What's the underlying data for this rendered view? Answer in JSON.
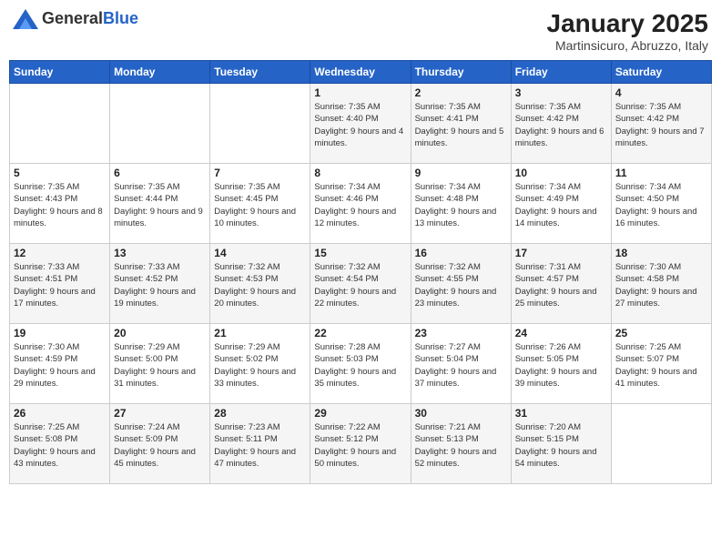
{
  "header": {
    "logo_general": "General",
    "logo_blue": "Blue",
    "title": "January 2025",
    "subtitle": "Martinsicuro, Abruzzo, Italy"
  },
  "days_of_week": [
    "Sunday",
    "Monday",
    "Tuesday",
    "Wednesday",
    "Thursday",
    "Friday",
    "Saturday"
  ],
  "weeks": [
    [
      {
        "day": "",
        "sunrise": "",
        "sunset": "",
        "daylight": "",
        "empty": true
      },
      {
        "day": "",
        "sunrise": "",
        "sunset": "",
        "daylight": "",
        "empty": true
      },
      {
        "day": "",
        "sunrise": "",
        "sunset": "",
        "daylight": "",
        "empty": true
      },
      {
        "day": "1",
        "sunrise": "Sunrise: 7:35 AM",
        "sunset": "Sunset: 4:40 PM",
        "daylight": "Daylight: 9 hours and 4 minutes."
      },
      {
        "day": "2",
        "sunrise": "Sunrise: 7:35 AM",
        "sunset": "Sunset: 4:41 PM",
        "daylight": "Daylight: 9 hours and 5 minutes."
      },
      {
        "day": "3",
        "sunrise": "Sunrise: 7:35 AM",
        "sunset": "Sunset: 4:42 PM",
        "daylight": "Daylight: 9 hours and 6 minutes."
      },
      {
        "day": "4",
        "sunrise": "Sunrise: 7:35 AM",
        "sunset": "Sunset: 4:42 PM",
        "daylight": "Daylight: 9 hours and 7 minutes."
      }
    ],
    [
      {
        "day": "5",
        "sunrise": "Sunrise: 7:35 AM",
        "sunset": "Sunset: 4:43 PM",
        "daylight": "Daylight: 9 hours and 8 minutes."
      },
      {
        "day": "6",
        "sunrise": "Sunrise: 7:35 AM",
        "sunset": "Sunset: 4:44 PM",
        "daylight": "Daylight: 9 hours and 9 minutes."
      },
      {
        "day": "7",
        "sunrise": "Sunrise: 7:35 AM",
        "sunset": "Sunset: 4:45 PM",
        "daylight": "Daylight: 9 hours and 10 minutes."
      },
      {
        "day": "8",
        "sunrise": "Sunrise: 7:34 AM",
        "sunset": "Sunset: 4:46 PM",
        "daylight": "Daylight: 9 hours and 12 minutes."
      },
      {
        "day": "9",
        "sunrise": "Sunrise: 7:34 AM",
        "sunset": "Sunset: 4:48 PM",
        "daylight": "Daylight: 9 hours and 13 minutes."
      },
      {
        "day": "10",
        "sunrise": "Sunrise: 7:34 AM",
        "sunset": "Sunset: 4:49 PM",
        "daylight": "Daylight: 9 hours and 14 minutes."
      },
      {
        "day": "11",
        "sunrise": "Sunrise: 7:34 AM",
        "sunset": "Sunset: 4:50 PM",
        "daylight": "Daylight: 9 hours and 16 minutes."
      }
    ],
    [
      {
        "day": "12",
        "sunrise": "Sunrise: 7:33 AM",
        "sunset": "Sunset: 4:51 PM",
        "daylight": "Daylight: 9 hours and 17 minutes."
      },
      {
        "day": "13",
        "sunrise": "Sunrise: 7:33 AM",
        "sunset": "Sunset: 4:52 PM",
        "daylight": "Daylight: 9 hours and 19 minutes."
      },
      {
        "day": "14",
        "sunrise": "Sunrise: 7:32 AM",
        "sunset": "Sunset: 4:53 PM",
        "daylight": "Daylight: 9 hours and 20 minutes."
      },
      {
        "day": "15",
        "sunrise": "Sunrise: 7:32 AM",
        "sunset": "Sunset: 4:54 PM",
        "daylight": "Daylight: 9 hours and 22 minutes."
      },
      {
        "day": "16",
        "sunrise": "Sunrise: 7:32 AM",
        "sunset": "Sunset: 4:55 PM",
        "daylight": "Daylight: 9 hours and 23 minutes."
      },
      {
        "day": "17",
        "sunrise": "Sunrise: 7:31 AM",
        "sunset": "Sunset: 4:57 PM",
        "daylight": "Daylight: 9 hours and 25 minutes."
      },
      {
        "day": "18",
        "sunrise": "Sunrise: 7:30 AM",
        "sunset": "Sunset: 4:58 PM",
        "daylight": "Daylight: 9 hours and 27 minutes."
      }
    ],
    [
      {
        "day": "19",
        "sunrise": "Sunrise: 7:30 AM",
        "sunset": "Sunset: 4:59 PM",
        "daylight": "Daylight: 9 hours and 29 minutes."
      },
      {
        "day": "20",
        "sunrise": "Sunrise: 7:29 AM",
        "sunset": "Sunset: 5:00 PM",
        "daylight": "Daylight: 9 hours and 31 minutes."
      },
      {
        "day": "21",
        "sunrise": "Sunrise: 7:29 AM",
        "sunset": "Sunset: 5:02 PM",
        "daylight": "Daylight: 9 hours and 33 minutes."
      },
      {
        "day": "22",
        "sunrise": "Sunrise: 7:28 AM",
        "sunset": "Sunset: 5:03 PM",
        "daylight": "Daylight: 9 hours and 35 minutes."
      },
      {
        "day": "23",
        "sunrise": "Sunrise: 7:27 AM",
        "sunset": "Sunset: 5:04 PM",
        "daylight": "Daylight: 9 hours and 37 minutes."
      },
      {
        "day": "24",
        "sunrise": "Sunrise: 7:26 AM",
        "sunset": "Sunset: 5:05 PM",
        "daylight": "Daylight: 9 hours and 39 minutes."
      },
      {
        "day": "25",
        "sunrise": "Sunrise: 7:25 AM",
        "sunset": "Sunset: 5:07 PM",
        "daylight": "Daylight: 9 hours and 41 minutes."
      }
    ],
    [
      {
        "day": "26",
        "sunrise": "Sunrise: 7:25 AM",
        "sunset": "Sunset: 5:08 PM",
        "daylight": "Daylight: 9 hours and 43 minutes."
      },
      {
        "day": "27",
        "sunrise": "Sunrise: 7:24 AM",
        "sunset": "Sunset: 5:09 PM",
        "daylight": "Daylight: 9 hours and 45 minutes."
      },
      {
        "day": "28",
        "sunrise": "Sunrise: 7:23 AM",
        "sunset": "Sunset: 5:11 PM",
        "daylight": "Daylight: 9 hours and 47 minutes."
      },
      {
        "day": "29",
        "sunrise": "Sunrise: 7:22 AM",
        "sunset": "Sunset: 5:12 PM",
        "daylight": "Daylight: 9 hours and 50 minutes."
      },
      {
        "day": "30",
        "sunrise": "Sunrise: 7:21 AM",
        "sunset": "Sunset: 5:13 PM",
        "daylight": "Daylight: 9 hours and 52 minutes."
      },
      {
        "day": "31",
        "sunrise": "Sunrise: 7:20 AM",
        "sunset": "Sunset: 5:15 PM",
        "daylight": "Daylight: 9 hours and 54 minutes."
      },
      {
        "day": "",
        "sunrise": "",
        "sunset": "",
        "daylight": "",
        "empty": true
      }
    ]
  ]
}
